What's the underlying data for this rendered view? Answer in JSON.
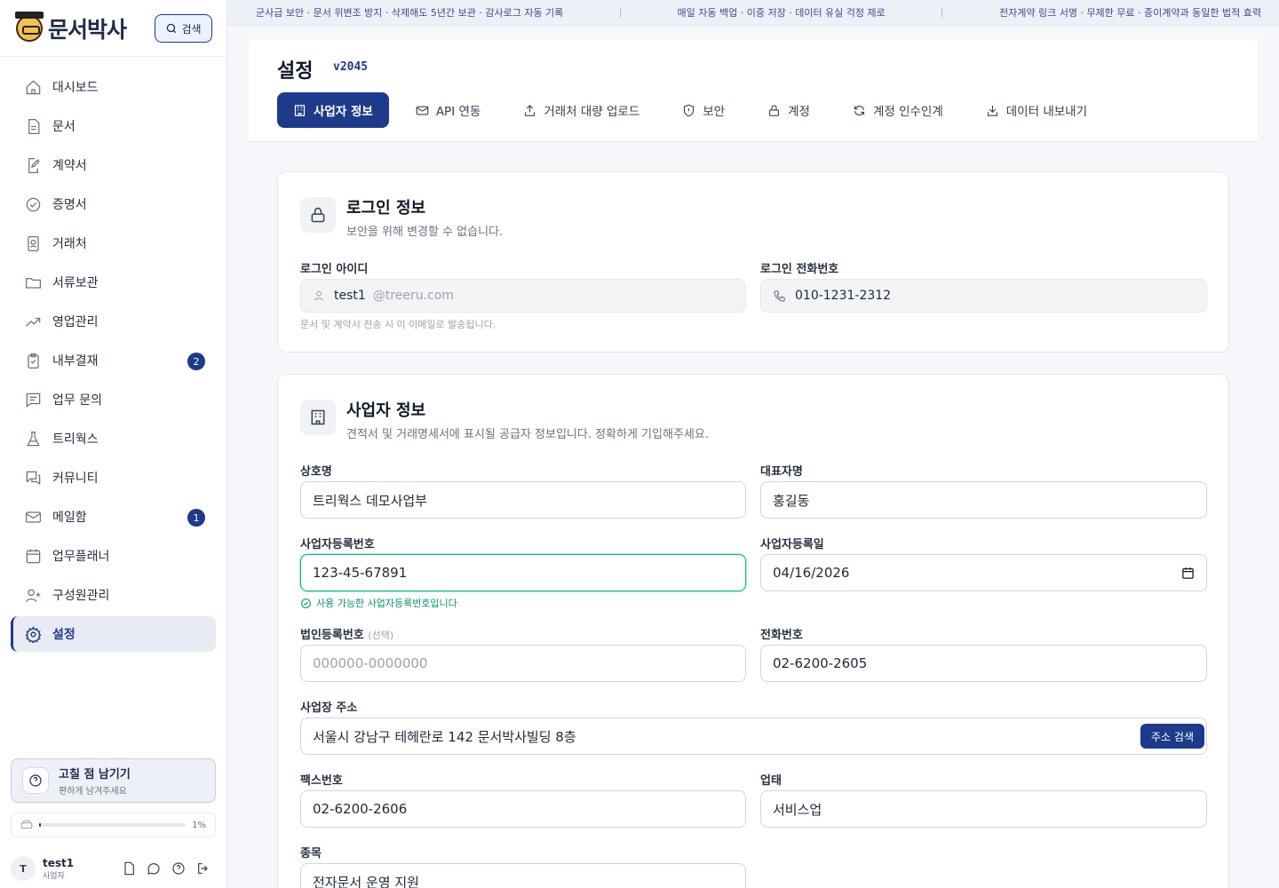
{
  "brand": {
    "name": "문서박사",
    "search_label": "검색"
  },
  "sidebar": {
    "items": [
      {
        "label": "대시보드"
      },
      {
        "label": "문서"
      },
      {
        "label": "계약서"
      },
      {
        "label": "증명서"
      },
      {
        "label": "거래처"
      },
      {
        "label": "서류보관"
      },
      {
        "label": "영업관리"
      },
      {
        "label": "내부결재",
        "badge": "2"
      },
      {
        "label": "업무 문의"
      },
      {
        "label": "트리웍스"
      },
      {
        "label": "커뮤니티"
      },
      {
        "label": "메일함",
        "badge": "1"
      },
      {
        "label": "업무플래너"
      },
      {
        "label": "구성원관리"
      },
      {
        "label": "설정"
      }
    ],
    "feedback": {
      "title": "고칠 점 남기기",
      "subtitle": "편하게 남겨주세요"
    },
    "storage": {
      "percent_label": "1%",
      "percent": 0.01
    },
    "user": {
      "initial": "T",
      "name": "test1",
      "role": "사업자"
    }
  },
  "banner": {
    "left": "군사급 보안 · 문서 위변조 방지 · 삭제해도 5년간 보관 · 감사로그 자동 기록",
    "center": "매일 자동 백업 · 이중 저장 · 데이터 유실 걱정 제로",
    "right": "전자계약 링크 서명 · 무제한 무료 · 종이계약과 동일한 법적 효력"
  },
  "settings": {
    "title": "설정",
    "version": "v2045",
    "tabs": [
      {
        "label": "사업자 정보"
      },
      {
        "label": "API 연동"
      },
      {
        "label": "거래처 대량 업로드"
      },
      {
        "label": "보안"
      },
      {
        "label": "계정"
      },
      {
        "label": "계정 인수인계"
      },
      {
        "label": "데이터 내보내기"
      }
    ]
  },
  "login_panel": {
    "title": "로그인 정보",
    "subtitle": "보안을 위해 변경할 수 없습니다.",
    "id_label": "로그인 아이디",
    "id_value": "test1",
    "id_domain": "@treeru.com",
    "id_hint": "문서 및 계약서 전송 시 이 이메일로 발송됩니다.",
    "phone_label": "로그인 전화번호",
    "phone_value": "010-1231-2312"
  },
  "business_panel": {
    "title": "사업자 정보",
    "subtitle": "견적서 및 거래명세서에 표시될 공급자 정보입니다. 정확하게 기입해주세요.",
    "company_label": "상호명",
    "company_value": "트리웍스 데모사업부",
    "ceo_label": "대표자명",
    "ceo_value": "홍길동",
    "bizno_label": "사업자등록번호",
    "bizno_value": "123-45-67891",
    "bizno_ok": "사용 가능한 사업자등록번호입니다",
    "regdate_label": "사업자등록일",
    "regdate_value": "04/16/2026",
    "corpno_label": "법인등록번호",
    "corpno_optional": "(선택)",
    "corpno_placeholder": "000000-0000000",
    "tel_label": "전화번호",
    "tel_value": "02-6200-2605",
    "address_label": "사업장 주소",
    "address_value": "서울시 강남구 테헤란로 142 문서박사빌딩 8층",
    "address_button": "주소 검색",
    "fax_label": "팩스번호",
    "fax_value": "02-6200-2606",
    "biztype_label": "업태",
    "biztype_value": "서비스업",
    "item_label": "종목",
    "item_value": "전자문서 운영 지원"
  }
}
